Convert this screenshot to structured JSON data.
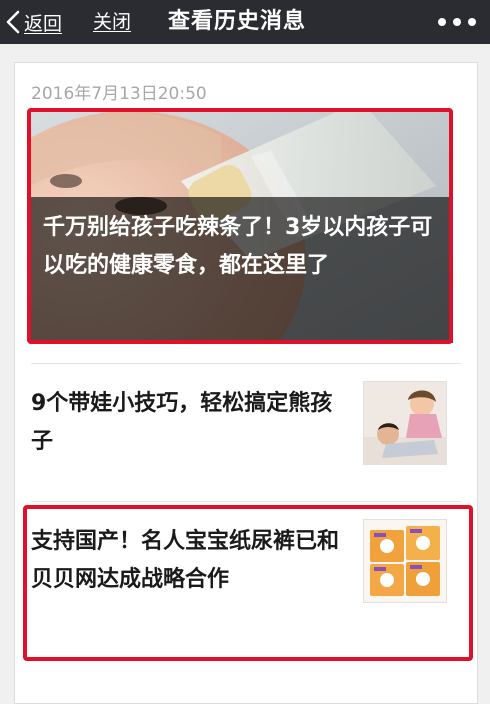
{
  "navbar": {
    "back_label": "返回",
    "close_label": "关闭",
    "title": "查看历史消息",
    "more_icon": "more-dots-icon"
  },
  "history": {
    "timestamp": "2016年7月13日20:50",
    "featured": {
      "title": "千万别给孩子吃辣条了！3岁以内孩子可以吃的健康零食，都在这里了"
    },
    "items": [
      {
        "title": "9个带娃小技巧，轻松搞定熊孩子",
        "thumb_icon": "parent-child-photo-icon"
      },
      {
        "title": "支持国产！名人宝宝纸尿裤已和贝贝网达成战略合作",
        "thumb_icon": "diaper-packs-photo-icon"
      }
    ]
  },
  "colors": {
    "navbar_bg": "#2b2c31",
    "highlight": "#e0102a",
    "timestamp": "#a7a7a7"
  }
}
